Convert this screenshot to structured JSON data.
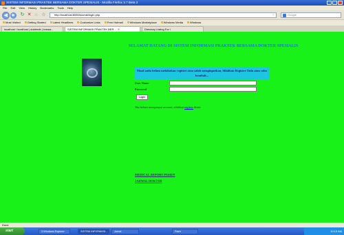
{
  "window": {
    "title": "SISTEM INFORMASI PRAKTEK BERSAMA DOKTER SPESIALIS - Mozilla Firefox 3.7 Beta 3"
  },
  "menu": [
    "File",
    "Edit",
    "View",
    "History",
    "Bookmarks",
    "Tools",
    "Help"
  ],
  "nav": {
    "url": "http://localhost:8080/koorak/login.php",
    "search_placeholder": "Google"
  },
  "bookmarks": [
    "Most Visited",
    "Getting Started",
    "Latest Headlines",
    "Customize Links",
    "Free Hotmail",
    "Windows Marketplace",
    "Windows Media",
    "Windows"
  ],
  "tabs": [
    "localhost / localhost | dokterdb | transa...",
    "SISTEM INFORMASI PRAKTEK BER...",
    "Directory Listing For /"
  ],
  "page": {
    "welcome": "SELAMAT DATANG DI SISTEM INFORMASI PRAKTEK BERSAMA DOKTER SPESIALIS",
    "notice": "Maaf anda belum melakukan register atau salah menginputkan, Silahkan Register Dulu atau coba kembali...",
    "username_label": "User Name",
    "password_label": "Password",
    "login_button": "Login",
    "register_prefix": "Jika belum mempunyai account, silahkan",
    "register_link": "register",
    "register_suffix": "disini",
    "link_medical": "MEDICAL REPORT PASIEN",
    "link_schedule": "JADWAL DOKTER"
  },
  "status": "Done",
  "taskbar": {
    "start": "start",
    "tasks": [
      "3 Windows Explorer",
      "SISTEM INFORMASI...",
      "Jurnal",
      "Paint"
    ],
    "clock": "10:15 AM"
  },
  "colors": {
    "page_background": "#19f219",
    "notice_background": "#1cc6e0",
    "welcome_text": "#1778d8"
  }
}
